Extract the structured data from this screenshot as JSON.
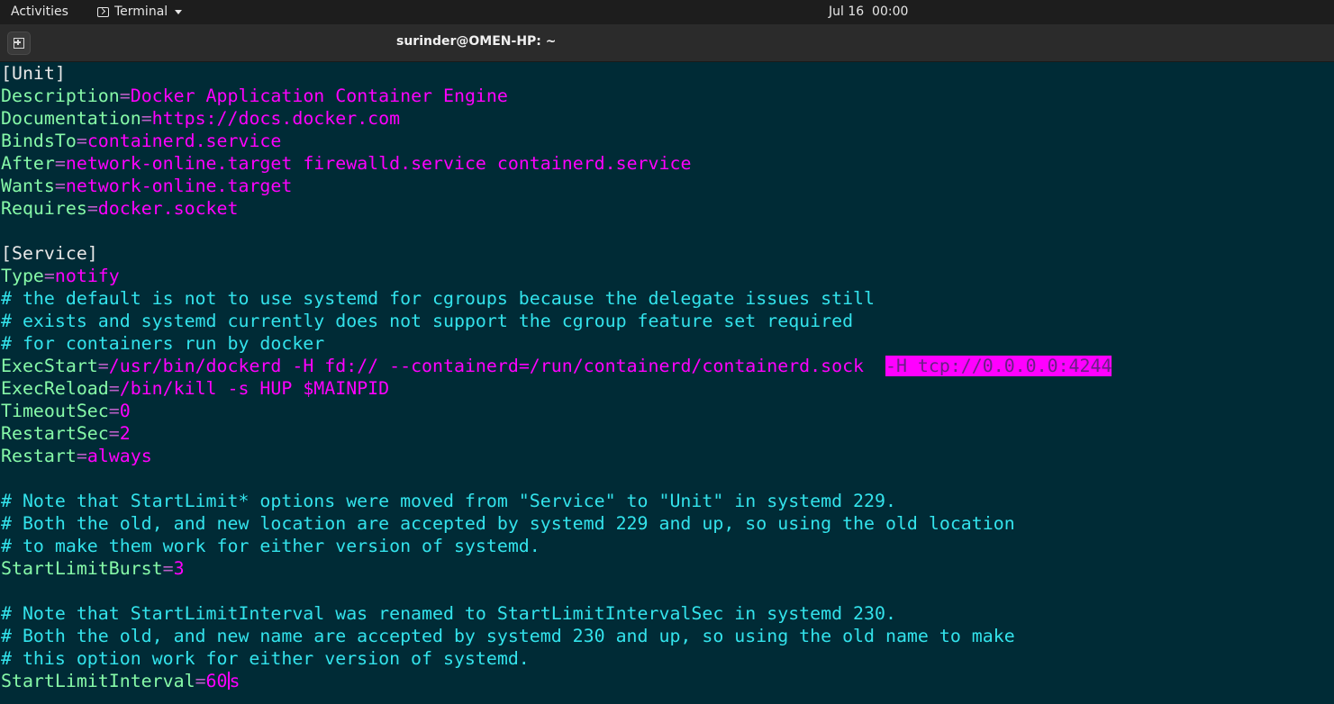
{
  "topbar": {
    "activities_label": "Activities",
    "app_menu_label": "Terminal",
    "clock": "Jul 16  00:00"
  },
  "window": {
    "title": "surinder@OMEN-HP: ~"
  },
  "colors": {
    "background": "#002b36",
    "key": "#86f9a8",
    "value": "#ff00ff",
    "comment": "#33e3ec",
    "highlight": "#ff00ff"
  },
  "editor": {
    "lines": [
      {
        "type": "section",
        "text": "[Unit]"
      },
      {
        "type": "kv",
        "key": "Description",
        "value": "Docker Application Container Engine"
      },
      {
        "type": "kv",
        "key": "Documentation",
        "value": "https://docs.docker.com"
      },
      {
        "type": "kv",
        "key": "BindsTo",
        "value": "containerd.service"
      },
      {
        "type": "kv",
        "key": "After",
        "value": "network-online.target firewalld.service containerd.service"
      },
      {
        "type": "kv",
        "key": "Wants",
        "value": "network-online.target"
      },
      {
        "type": "kv",
        "key": "Requires",
        "value": "docker.socket"
      },
      {
        "type": "blank",
        "text": ""
      },
      {
        "type": "section",
        "text": "[Service]"
      },
      {
        "type": "kv",
        "key": "Type",
        "value": "notify"
      },
      {
        "type": "comment",
        "text": "# the default is not to use systemd for cgroups because the delegate issues still"
      },
      {
        "type": "comment",
        "text": "# exists and systemd currently does not support the cgroup feature set required"
      },
      {
        "type": "comment",
        "text": "# for containers run by docker"
      },
      {
        "type": "kv",
        "key": "ExecStart",
        "value": "/usr/bin/dockerd -H fd:// --containerd=/run/containerd/containerd.sock  ",
        "highlight": "-H tcp://0.0.0.0:4244"
      },
      {
        "type": "kv",
        "key": "ExecReload",
        "value": "/bin/kill -s HUP $MAINPID"
      },
      {
        "type": "kv",
        "key": "TimeoutSec",
        "value": "0"
      },
      {
        "type": "kv",
        "key": "RestartSec",
        "value": "2"
      },
      {
        "type": "kv",
        "key": "Restart",
        "value": "always"
      },
      {
        "type": "blank",
        "text": ""
      },
      {
        "type": "comment",
        "text": "# Note that StartLimit* options were moved from \"Service\" to \"Unit\" in systemd 229."
      },
      {
        "type": "comment",
        "text": "# Both the old, and new location are accepted by systemd 229 and up, so using the old location"
      },
      {
        "type": "comment",
        "text": "# to make them work for either version of systemd."
      },
      {
        "type": "kv",
        "key": "StartLimitBurst",
        "value": "3"
      },
      {
        "type": "blank",
        "text": ""
      },
      {
        "type": "comment",
        "text": "# Note that StartLimitInterval was renamed to StartLimitIntervalSec in systemd 230."
      },
      {
        "type": "comment",
        "text": "# Both the old, and new name are accepted by systemd 230 and up, so using the old name to make"
      },
      {
        "type": "comment",
        "text": "# this option work for either version of systemd."
      },
      {
        "type": "kv",
        "key": "StartLimitInterval",
        "value": "60",
        "after_cursor": "s"
      }
    ]
  }
}
